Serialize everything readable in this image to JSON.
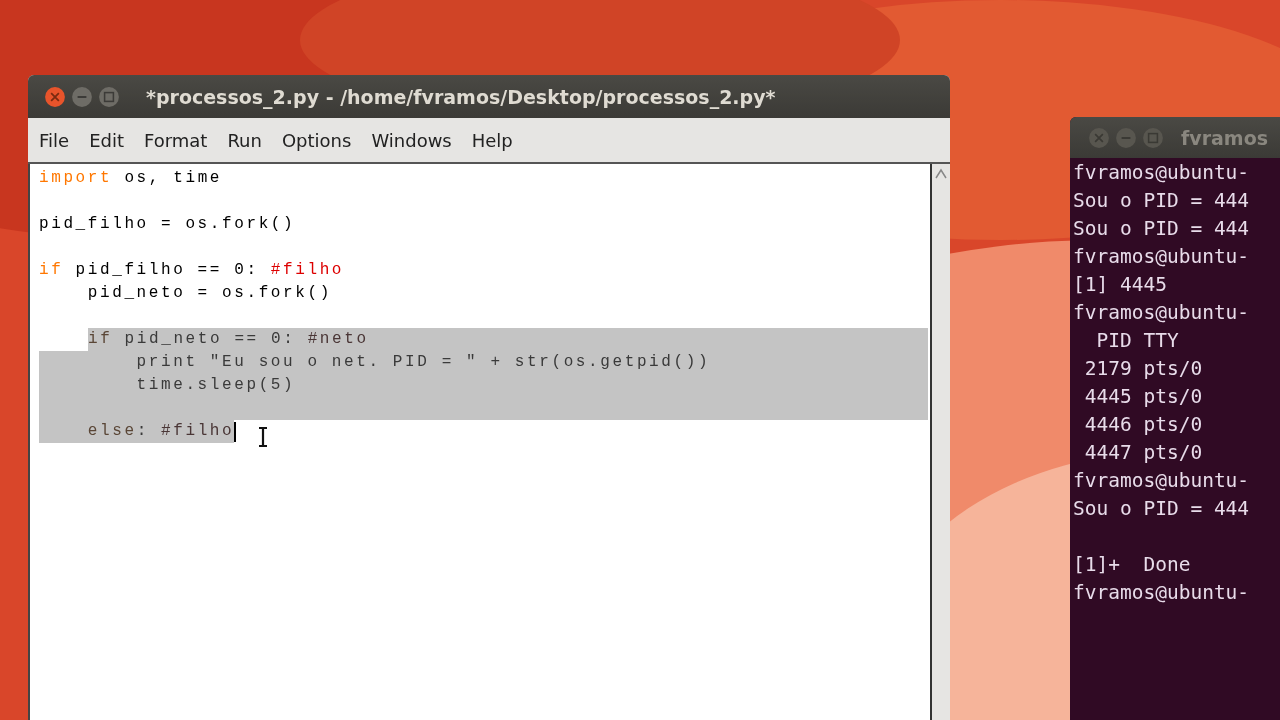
{
  "editor": {
    "title": "*processos_2.py - /home/fvramos/Desktop/processos_2.py*",
    "menu": [
      {
        "label": "File"
      },
      {
        "label": "Edit"
      },
      {
        "label": "Format"
      },
      {
        "label": "Run"
      },
      {
        "label": "Options"
      },
      {
        "label": "Windows"
      },
      {
        "label": "Help"
      }
    ],
    "lines": [
      {
        "kind": "code",
        "selected": false,
        "newline_selected": false,
        "tokens": [
          {
            "kind": "keyword",
            "text": "import"
          },
          {
            "kind": "plain",
            "text": " os, time"
          }
        ]
      },
      {
        "kind": "blank",
        "newline_selected": false
      },
      {
        "kind": "code",
        "selected": false,
        "newline_selected": false,
        "tokens": [
          {
            "kind": "plain",
            "text": "pid_filho = os.fork()"
          }
        ]
      },
      {
        "kind": "blank",
        "newline_selected": false
      },
      {
        "kind": "code",
        "selected": false,
        "newline_selected": false,
        "tokens": [
          {
            "kind": "keyword",
            "text": "if"
          },
          {
            "kind": "plain",
            "text": " pid_filho == 0: "
          },
          {
            "kind": "comment",
            "text": "#filho"
          }
        ]
      },
      {
        "kind": "code",
        "selected": false,
        "newline_selected": false,
        "tokens": [
          {
            "kind": "plain",
            "text": "    pid_neto = os.fork()"
          }
        ]
      },
      {
        "kind": "blank",
        "newline_selected": false
      },
      {
        "kind": "indented",
        "indent_selected": false,
        "selected": true,
        "newline_selected": true,
        "tokens": [
          {
            "kind": "keyword",
            "text": "if"
          },
          {
            "kind": "plain",
            "text": " pid_neto == 0: "
          },
          {
            "kind": "comment",
            "text": "#neto"
          }
        ]
      },
      {
        "kind": "code",
        "selected": true,
        "newline_selected": true,
        "tokens": [
          {
            "kind": "plain",
            "text": "        print \"Eu sou o net. PID = \" + str(os.getpid())"
          }
        ]
      },
      {
        "kind": "code",
        "selected": true,
        "newline_selected": true,
        "tokens": [
          {
            "kind": "plain",
            "text": "        time.sleep(5)"
          }
        ]
      },
      {
        "kind": "blank",
        "newline_selected": true
      },
      {
        "kind": "code",
        "selected": true,
        "newline_selected": false,
        "caret": true,
        "tokens": [
          {
            "kind": "keyword",
            "text": "    else"
          },
          {
            "kind": "plain",
            "text": ": "
          },
          {
            "kind": "comment",
            "text": "#filho"
          }
        ]
      }
    ]
  },
  "terminal": {
    "title": "fvramos",
    "sections": [
      {
        "lines": [
          "fvramos@ubuntu-",
          "Sou o PID = 444",
          "Sou o PID = 444",
          "fvramos@ubuntu-",
          "[1] 4445",
          "fvramos@ubuntu-",
          "  PID TTY",
          " 2179 pts/0",
          " 4445 pts/0",
          " 4446 pts/0",
          " 4447 pts/0",
          "fvramos@ubuntu-",
          "Sou o PID = 444"
        ]
      },
      {
        "lines": [
          "[1]+  Done",
          "fvramos@ubuntu-"
        ]
      }
    ]
  }
}
